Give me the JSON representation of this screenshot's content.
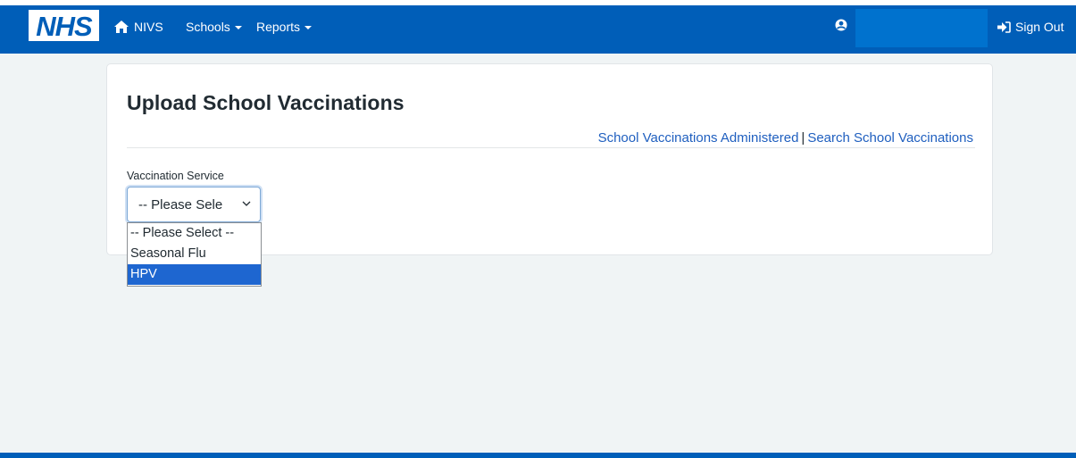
{
  "header": {
    "logo_text": "NHS",
    "home_label": "NIVS",
    "nav": [
      {
        "label": "Schools"
      },
      {
        "label": "Reports"
      }
    ],
    "user_name": "",
    "sign_out_label": "Sign Out"
  },
  "page": {
    "title": "Upload School Vaccinations",
    "links": [
      {
        "label": "School Vaccinations Administered"
      },
      {
        "label": "Search School Vaccinations"
      }
    ],
    "link_separator": "|"
  },
  "form": {
    "vaccination_service": {
      "label": "Vaccination Service",
      "selected_display": "-- Please Sele",
      "options": [
        {
          "label": "-- Please Select --"
        },
        {
          "label": "Seasonal Flu"
        },
        {
          "label": "HPV"
        }
      ],
      "highlighted_option": "HPV"
    }
  },
  "icons": {
    "home": "home-icon",
    "user": "user-circle-icon",
    "sign_out": "sign-out-icon",
    "dropdown": "chevron-down-icon"
  },
  "colors": {
    "nav_blue": "#005eb8",
    "link_blue": "#1f5fbf",
    "highlight": "#1e66d0"
  }
}
